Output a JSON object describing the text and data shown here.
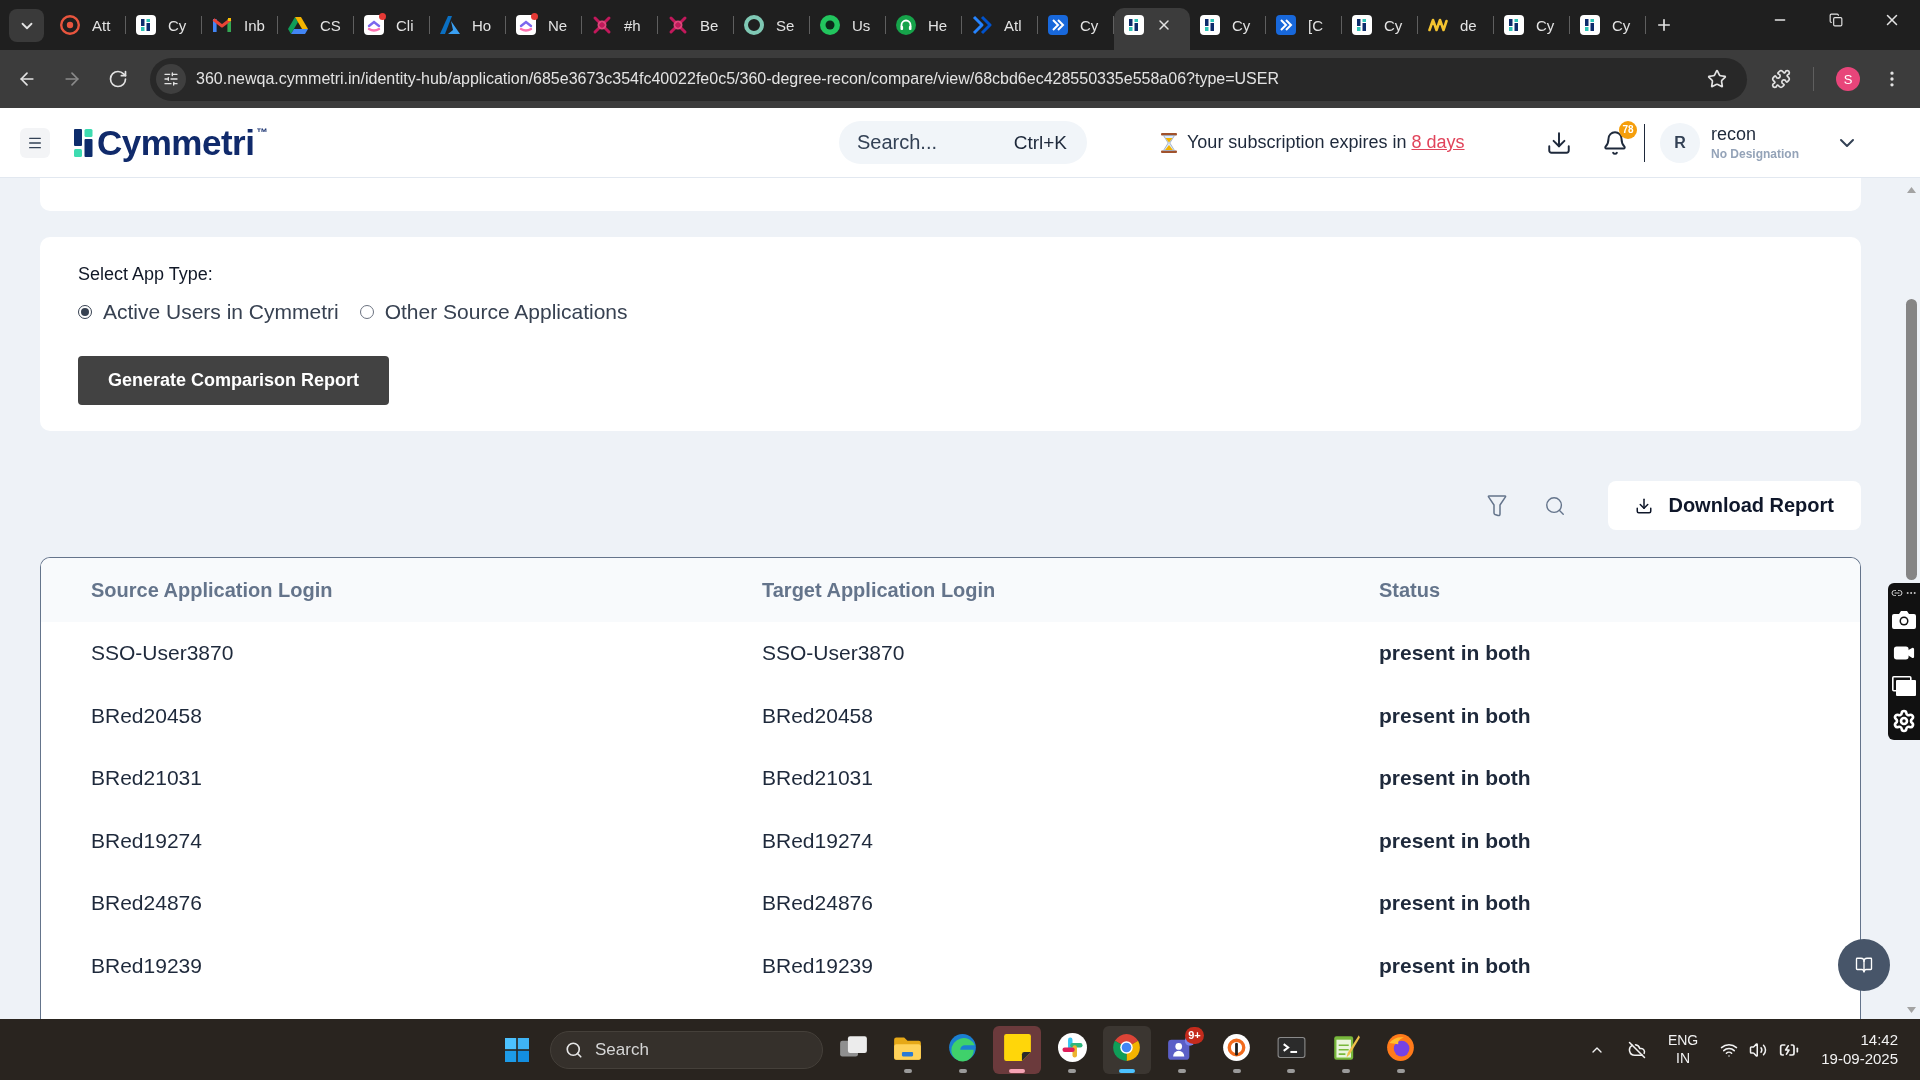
{
  "browser": {
    "tabs": [
      {
        "kind": "hr",
        "title": "Att",
        "selected": false,
        "unread": false
      },
      {
        "kind": "logo-tile",
        "title": "Cy",
        "selected": false,
        "unread": false
      },
      {
        "kind": "mail",
        "title": "Inb",
        "selected": false,
        "unread": false
      },
      {
        "kind": "triangle",
        "title": "CS",
        "selected": false,
        "unread": false
      },
      {
        "kind": "check-tile",
        "title": "Cli",
        "selected": false,
        "unread": true
      },
      {
        "kind": "peak",
        "title": "Ho",
        "selected": false,
        "unread": false
      },
      {
        "kind": "check-tile",
        "title": "Ne",
        "selected": false,
        "unread": true
      },
      {
        "kind": "cross",
        "title": "#h",
        "selected": false,
        "unread": false
      },
      {
        "kind": "cross",
        "title": "Be",
        "selected": false,
        "unread": false
      },
      {
        "kind": "ring",
        "title": "Se",
        "selected": false,
        "unread": false
      },
      {
        "kind": "dot-ring",
        "title": "Us",
        "selected": false,
        "unread": false
      },
      {
        "kind": "headset",
        "title": "He",
        "selected": false,
        "unread": false
      },
      {
        "kind": "chevrons",
        "title": "Atl",
        "selected": false,
        "unread": false
      },
      {
        "kind": "chevrons-tile",
        "title": "Cy",
        "selected": false,
        "unread": false
      },
      {
        "kind": "logo-tile",
        "selected": true,
        "unread": false
      },
      {
        "kind": "logo-tile",
        "title": "Cy",
        "selected": false,
        "unread": false
      },
      {
        "kind": "chevrons-tile",
        "title": "[C",
        "selected": false,
        "unread": false
      },
      {
        "kind": "logo-tile",
        "title": "Cy",
        "selected": false,
        "unread": false
      },
      {
        "kind": "zigzag",
        "title": "de",
        "selected": false,
        "unread": false
      },
      {
        "kind": "logo-tile",
        "title": "Cy",
        "selected": false,
        "unread": false
      },
      {
        "kind": "logo-tile",
        "title": "Cy",
        "selected": false,
        "unread": false
      }
    ],
    "url": "360.newqa.cymmetri.in/identity-hub/application/685e3673c354fc40022fe0c5/360-degree-recon/compare/view/68cbd6ec428550335e558a06?type=USER",
    "profile_initial": "S"
  },
  "header": {
    "logo": "Cymmetri$^{™}$",
    "search": {
      "placeholder": "Search...",
      "shortcut": "Ctrl+K"
    },
    "subscription": {
      "text": "Your subscription expires in",
      "link": "8 days"
    },
    "notification_count": "78",
    "user": {
      "initial": "R",
      "name": "recon",
      "designation": "No Designation"
    }
  },
  "app_type": {
    "label": "Select App Type:",
    "options": [
      {
        "label": "Active Users in Cymmetri",
        "selected": true
      },
      {
        "label": "Other Source Applications",
        "selected": false
      }
    ],
    "button": "Generate Comparison Report"
  },
  "report_toolbar": {
    "download_button": "Download Report"
  },
  "table": {
    "columns": [
      "Source Application Login",
      "Target Application Login",
      "Status"
    ],
    "rows": [
      {
        "source": "SSO-User3870",
        "target": "SSO-User3870",
        "status": "present in both"
      },
      {
        "source": "BRed20458",
        "target": "BRed20458",
        "status": "present in both"
      },
      {
        "source": "BRed21031",
        "target": "BRed21031",
        "status": "present in both"
      },
      {
        "source": "BRed19274",
        "target": "BRed19274",
        "status": "present in both"
      },
      {
        "source": "BRed24876",
        "target": "BRed24876",
        "status": "present in both"
      },
      {
        "source": "BRed19239",
        "target": "BRed19239",
        "status": "present in both"
      }
    ]
  },
  "taskbar": {
    "search": {
      "placeholder": "Search"
    },
    "apps": [
      {
        "kind": "task-view",
        "running": false,
        "focused": false,
        "flashing": false
      },
      {
        "kind": "folder",
        "running": true,
        "focused": false,
        "flashing": false
      },
      {
        "kind": "swirl",
        "running": true,
        "focused": false,
        "flashing": false
      },
      {
        "kind": "note",
        "running": true,
        "focused": false,
        "flashing": true
      },
      {
        "kind": "hash",
        "running": true,
        "focused": false,
        "flashing": false
      },
      {
        "kind": "segmented-circle",
        "running": true,
        "focused": true,
        "flashing": false
      },
      {
        "kind": "people-tile",
        "running": true,
        "focused": false,
        "flashing": false,
        "badge": "9+"
      },
      {
        "kind": "ring",
        "running": true,
        "focused": false,
        "flashing": false
      },
      {
        "kind": "terminal",
        "running": true,
        "focused": false,
        "flashing": false
      },
      {
        "kind": "notepad",
        "running": true,
        "focused": false,
        "flashing": false
      },
      {
        "kind": "orb",
        "running": true,
        "focused": false,
        "flashing": false
      }
    ],
    "language": "ENG",
    "region": "IN",
    "time": "14:42",
    "date": "19-09-2025"
  }
}
